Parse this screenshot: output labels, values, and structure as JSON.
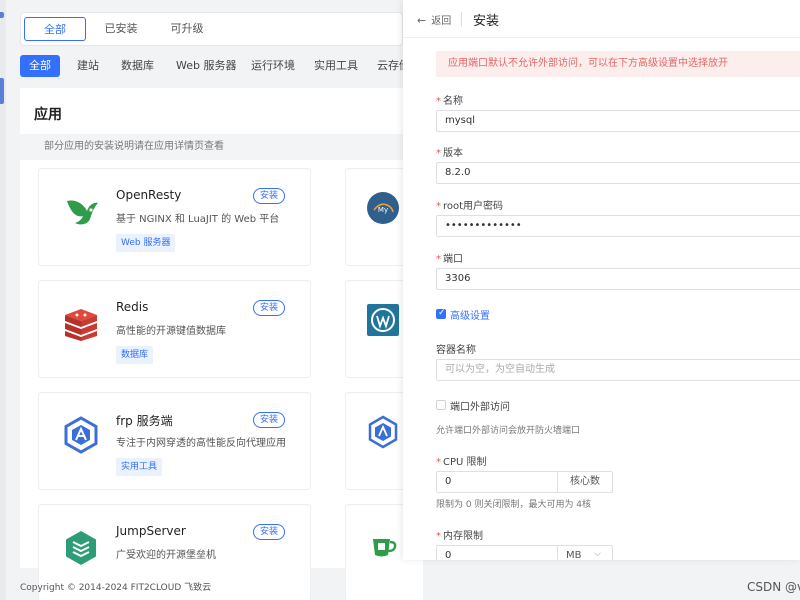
{
  "top_tabs": [
    "全部",
    "已安装",
    "可升级"
  ],
  "categories": [
    "全部",
    "建站",
    "数据库",
    "Web 服务器",
    "运行环境",
    "实用工具",
    "云存储"
  ],
  "apps_section": {
    "title": "应用",
    "note": "部分应用的安装说明请在应用详情页查看"
  },
  "apps": [
    {
      "name": "OpenResty",
      "desc": "基于 NGINX 和 LuaJIT 的 Web 平台",
      "tag": "Web 服务器",
      "icon": "openresty-icon"
    },
    {
      "name": "Redis",
      "desc": "高性能的开源键值数据库",
      "tag": "数据库",
      "icon": "redis-icon"
    },
    {
      "name": "frp 服务端",
      "desc": "专注于内网穿透的高性能反向代理应用",
      "tag": "实用工具",
      "icon": "frp-icon"
    },
    {
      "name": "JumpServer",
      "desc": "广受欢迎的开源堡垒机",
      "tag": "",
      "icon": "jumpserver-icon"
    }
  ],
  "install_label": "安装",
  "footer": "Copyright © 2014-2024 FIT2CLOUD 飞致云",
  "drawer": {
    "back_label": "返回",
    "title": "安装",
    "alert": "应用端口默认不允许外部访问，可以在下方高级设置中选择放开",
    "fields": {
      "name": {
        "label": "名称",
        "value": "mysql"
      },
      "version": {
        "label": "版本",
        "value": "8.2.0"
      },
      "root_password": {
        "label": "root用户密码",
        "value": "•••••••••••••"
      },
      "port": {
        "label": "端口",
        "value": "3306"
      }
    },
    "advanced_label": "高级设置",
    "container_name_label": "容器名称",
    "container_name_placeholder": "可以为空，为空自动生成",
    "external_access_label": "端口外部访问",
    "external_access_hint": "允许端口外部访问会放开防火墙端口",
    "cpu": {
      "label": "CPU 限制",
      "value": "0",
      "unit": "核心数",
      "hint": "限制为 0 则关闭限制，最大可用为 4核"
    },
    "memory": {
      "label": "内存限制",
      "value": "0",
      "unit": "MB"
    }
  },
  "watermark": "CSDN @v"
}
